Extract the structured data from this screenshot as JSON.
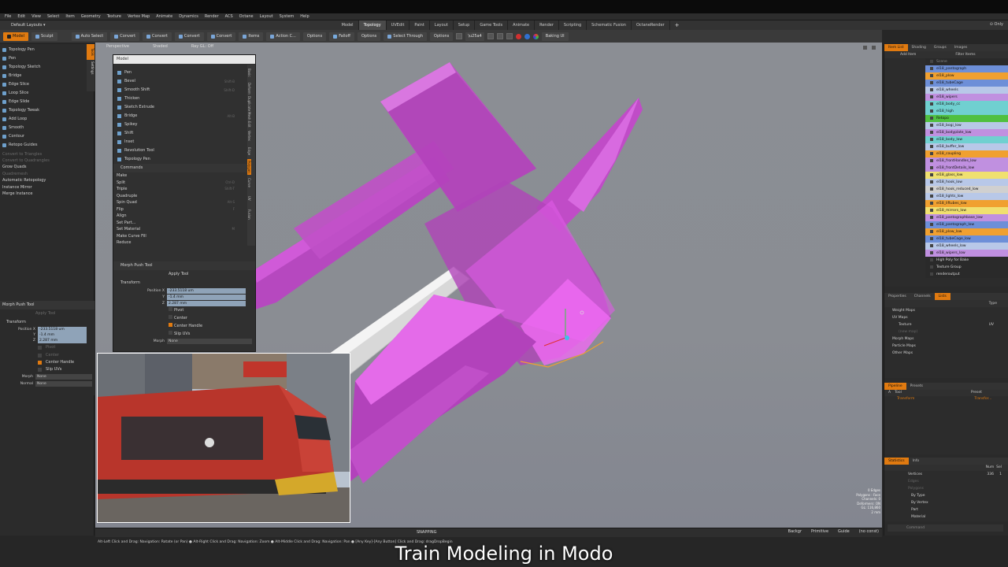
{
  "menu": [
    "File",
    "Edit",
    "View",
    "Select",
    "Item",
    "Geometry",
    "Texture",
    "Vertex Map",
    "Animate",
    "Dynamics",
    "Render",
    "ACS",
    "Octane",
    "Layout",
    "System",
    "Help"
  ],
  "layout_selector": "Default Layouts ▾",
  "tabs": [
    "Model",
    "Topology",
    "UVEdit",
    "Paint",
    "Layout",
    "Setup",
    "Game Tools",
    "Animate",
    "Render",
    "Scripting",
    "Schematic Fusion",
    "OctaneRender"
  ],
  "active_tab": "Topology",
  "only_label": "⊙ Only",
  "toolbar": {
    "model": "Model",
    "sculpt": "Sculpt",
    "auto_select": "Auto Select",
    "convert1": "Convert",
    "convert2": "Convert",
    "convert3": "Convert",
    "convert4": "Convert",
    "items": "Items",
    "action": "Action C...",
    "options1": "Options",
    "falloff": "Falloff",
    "options2": "Options",
    "select_through": "Select Through",
    "options3": "Options",
    "baking": "Baking UI"
  },
  "left_tools": [
    "Topology Pen",
    "Pen",
    "Topology Sketch",
    "Bridge",
    "Edge Slice",
    "Loop Slice",
    "Edge Slide",
    "Topology Tweak",
    "Add Loop",
    "Smooth",
    "Contour",
    "Retopo Guides"
  ],
  "left_dim": [
    "Convert to Triangles",
    "Convert to Quadrangles"
  ],
  "left_misc": [
    "Grow Quads",
    "Quadremesh",
    "Automatic Retopology",
    "Instance Mirror",
    "Merge Instance"
  ],
  "left_props": {
    "title": "Morph Push Tool",
    "apply": "Apply Tool",
    "transform": "Transform",
    "position": "Position X",
    "x": "-233.5118 um",
    "y": "-1.4 mm",
    "z": "2.287 mm",
    "pivot": "Pivot",
    "center": "Center",
    "center_handle": "Center Handle",
    "slip_uvs": "Slip UVs",
    "morph_label": "Morph",
    "morph_val": "None",
    "normal_label": "Normal",
    "normal_val": "None"
  },
  "left_vtabs": [
    "Tools",
    "Settings"
  ],
  "viewport": {
    "view": "Perspective",
    "shade": "Shaded",
    "ray": "Ray GL: Off",
    "snapping": "SNAPPING",
    "stats": [
      "0 Edges",
      "Polygons : Face",
      "Channels: 0",
      "Deformers: ON",
      "GL: 116,860",
      "2 mm"
    ],
    "status_btns": [
      "Backgr",
      "Primitive",
      "Guide",
      "(no const)"
    ],
    "hint": "Alt-Left Click and Drag: Navigation: Rotate (or Pan) ● Alt-Right Click and Drag: Navigation: Zoom ● Alt-Middle Click and Drag: Navigation: Pan ● [Any Key]-[Any Button] Click and Drag: dragDropBegin"
  },
  "model_panel": {
    "title": "Model",
    "tools": [
      {
        "label": "Pen",
        "sc": ""
      },
      {
        "label": "Bevel",
        "sc": "Shift-B"
      },
      {
        "label": "Smooth Shift",
        "sc": "Shift-D"
      },
      {
        "label": "Thicken",
        "sc": ""
      },
      {
        "label": "Sketch Extrude",
        "sc": ""
      },
      {
        "label": "Bridge",
        "sc": "Alt-B"
      },
      {
        "label": "Spikey",
        "sc": ""
      },
      {
        "label": "Shift",
        "sc": ""
      },
      {
        "label": "Inset",
        "sc": ""
      },
      {
        "label": "Revolution Tool",
        "sc": ""
      },
      {
        "label": "Topology Pen",
        "sc": ""
      }
    ],
    "commands_header": "Commands",
    "commands": [
      {
        "label": "Make",
        "sc": ""
      },
      {
        "label": "Split",
        "sc": "Ctrl-D"
      },
      {
        "label": "Triple",
        "sc": "Shift-T"
      },
      {
        "label": "Quadruple",
        "sc": ""
      },
      {
        "label": "Spin Quad",
        "sc": "Alt-S"
      },
      {
        "label": "Flip",
        "sc": "F"
      },
      {
        "label": "Align",
        "sc": ""
      },
      {
        "label": "Set Part...",
        "sc": ""
      },
      {
        "label": "Set Material",
        "sc": "M"
      },
      {
        "label": "Make Curve Fill",
        "sc": ""
      },
      {
        "label": "Reduce",
        "sc": ""
      }
    ],
    "vtabs": [
      "Basic",
      "Deform",
      "Duplicate",
      "Mesh Edit",
      "Vertex",
      "Edge",
      "Polygon",
      "Curve",
      "UV",
      "Fusion"
    ],
    "morph_push": "Morph Push Tool",
    "apply": "Apply Tool",
    "transform": "Transform",
    "position": "Position X",
    "x": "-233.5118 um",
    "y": "-1.4 mm",
    "z": "2.287 mm",
    "pivot": "Pivot",
    "center": "Center",
    "center_handle": "Center Handle",
    "slip_uvs": "Slip UVs",
    "morph_label": "Morph",
    "morph_val": "None"
  },
  "items_panel": {
    "tabs": [
      "Item List",
      "Shading",
      "Groups",
      "Images"
    ],
    "add": "Add Item",
    "filter": "Filter Items",
    "items": [
      {
        "label": "Scene",
        "color": "#2a2a2a",
        "text": "#888"
      },
      {
        "label": "el18_pantograph",
        "color": "#6d8fd8",
        "text": "#111"
      },
      {
        "label": "el18_plow",
        "color": "#f0a030",
        "text": "#111"
      },
      {
        "label": "el18_tubeCage",
        "color": "#6d8fd8",
        "text": "#111"
      },
      {
        "label": "el18_wheels",
        "color": "#b8c8e8",
        "text": "#111"
      },
      {
        "label": "el18_wipers",
        "color": "#c090e0",
        "text": "#111"
      },
      {
        "label": "el18_body_cc",
        "color": "#70d0d0",
        "text": "#111"
      },
      {
        "label": "el18_high",
        "color": "#70d0d0",
        "text": "#111"
      },
      {
        "label": "Retopo",
        "color": "#50c040",
        "text": "#111"
      },
      {
        "label": "el18_bogi_low",
        "color": "#b8c8e8",
        "text": "#111"
      },
      {
        "label": "el18_bodyplate_low",
        "color": "#c090e0",
        "text": "#111"
      },
      {
        "label": "el18_body_low",
        "color": "#70d0d0",
        "text": "#111"
      },
      {
        "label": "el18_buffer_low",
        "color": "#b8c8e8",
        "text": "#111"
      },
      {
        "label": "el18_coupling",
        "color": "#f0a030",
        "text": "#111"
      },
      {
        "label": "el18_frontHandles_low",
        "color": "#c090e0",
        "text": "#111"
      },
      {
        "label": "el18_frontDetails_low",
        "color": "#c090e0",
        "text": "#111"
      },
      {
        "label": "el18_glass_low",
        "color": "#f0e070",
        "text": "#111"
      },
      {
        "label": "el18_hook_low",
        "color": "#b8c8e8",
        "text": "#111"
      },
      {
        "label": "el18_hook_reduced_low",
        "color": "#d0d0d0",
        "text": "#111"
      },
      {
        "label": "el18_lights_low",
        "color": "#b8c8e8",
        "text": "#111"
      },
      {
        "label": "el18_liftubes_low",
        "color": "#f0a030",
        "text": "#111"
      },
      {
        "label": "el18_mirrors_low",
        "color": "#f0e070",
        "text": "#111"
      },
      {
        "label": "el18_pantographbase_low",
        "color": "#c090e0",
        "text": "#111"
      },
      {
        "label": "el18_pantograph_low",
        "color": "#6d8fd8",
        "text": "#111"
      },
      {
        "label": "el18_plow_low",
        "color": "#f0a030",
        "text": "#111"
      },
      {
        "label": "el18_tubeCage_low",
        "color": "#6d8fd8",
        "text": "#111"
      },
      {
        "label": "el18_wheels_low",
        "color": "#b8c8e8",
        "text": "#111"
      },
      {
        "label": "el18_wipers_low",
        "color": "#c090e0",
        "text": "#111"
      },
      {
        "label": "High Poly for Bake",
        "color": "#2a2a2a",
        "text": "#ddd"
      },
      {
        "label": "Texture Group",
        "color": "#2a2a2a",
        "text": "#ddd"
      },
      {
        "label": "renderoutput",
        "color": "#2a2a2a",
        "text": "#ddd"
      }
    ]
  },
  "props_panel": {
    "tabs": [
      "Properties",
      "Channels",
      "Lists"
    ],
    "type_col": "Type",
    "rows": [
      "Weight Maps",
      "UV Maps",
      "Texture",
      "(new map)",
      "Morph Maps",
      "Particle Maps",
      "Other Maps"
    ],
    "texture_type": "UV"
  },
  "pipeline_panel": {
    "tabs": [
      "Pipeline",
      "Presets"
    ],
    "cols": [
      "A",
      "Tool",
      "Preset"
    ],
    "row": [
      "Transform",
      "Transfor..."
    ]
  },
  "stats_panel": {
    "tabs": [
      "Statistics",
      "Info"
    ],
    "cols": [
      "Num",
      "Sel"
    ],
    "rows": [
      {
        "label": "Vertices",
        "num": "336",
        "sel": "1"
      },
      {
        "label": "Edges",
        "num": "",
        "sel": ""
      },
      {
        "label": "Polygons",
        "num": "",
        "sel": ""
      },
      {
        "label": "By Type",
        "num": "",
        "sel": ""
      },
      {
        "label": "By Vertex",
        "num": "",
        "sel": ""
      },
      {
        "label": "Part",
        "num": "",
        "sel": ""
      },
      {
        "label": "Material",
        "num": "",
        "sel": ""
      }
    ],
    "command": "Command"
  },
  "caption": "Train Modeling in Modo",
  "colors": {
    "accent": "#e07a10",
    "magenta": "#d040d8"
  }
}
